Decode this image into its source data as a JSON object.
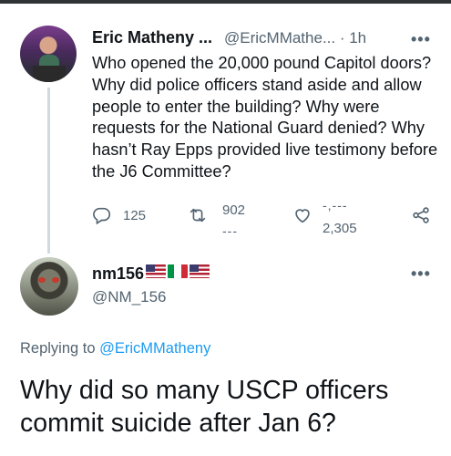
{
  "original_tweet": {
    "display_name": "Eric Matheny ...",
    "handle_time": "@EricMMathe... · 1h",
    "text": "Who opened the 20,000 pound Capitol doors? Why did police officers stand aside and allow people to enter the building? Why were requests for the National Guard denied? Why hasn’t Ray Epps provided live testimony before the J6 Committee?",
    "actions": {
      "reply_count": "125",
      "retweet_count": "902",
      "retweet_count_next": "---",
      "like_count_prev": "-,---",
      "like_count": "2,305"
    },
    "more_icon": "ellipsis-icon"
  },
  "reply_tweet": {
    "display_name": "nm156",
    "flags": [
      "us-flag-icon",
      "italy-flag-icon",
      "us-flag-icon"
    ],
    "handle": "@NM_156",
    "replying_prefix": "Replying to ",
    "replying_to": "@EricMMatheny",
    "text": "Why did so many USCP officers commit suicide after Jan 6?",
    "more_icon": "ellipsis-icon"
  },
  "colors": {
    "text": "#0f1419",
    "secondary": "#536471",
    "link": "#1d9bf0",
    "thread_line": "#cfd9de"
  }
}
